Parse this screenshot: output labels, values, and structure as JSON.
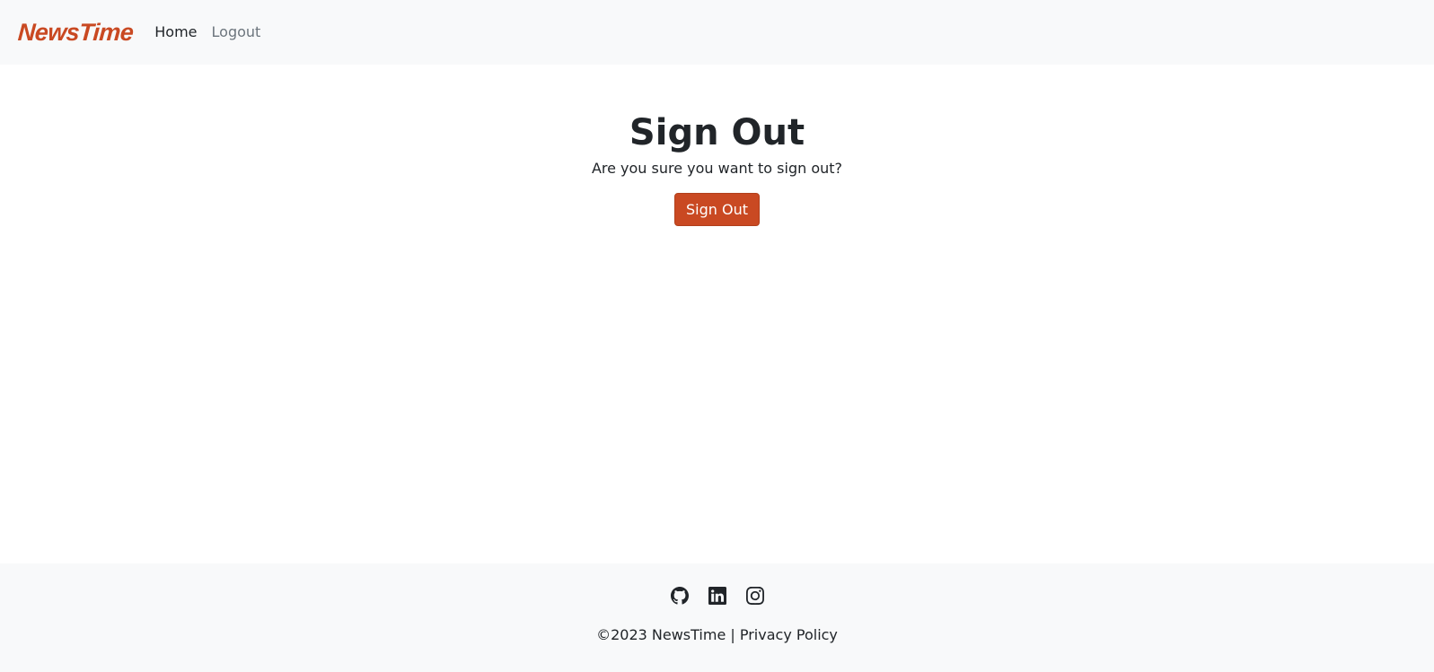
{
  "navbar": {
    "brand": "NewsTime",
    "links": [
      {
        "label": "Home"
      },
      {
        "label": "Logout"
      }
    ]
  },
  "main": {
    "title": "Sign Out",
    "subtitle": "Are you sure you want to sign out?",
    "button_label": "Sign Out"
  },
  "footer": {
    "social_icons": [
      "github-icon",
      "linkedin-icon",
      "instagram-icon"
    ],
    "copyright": "©2023 NewsTime |",
    "privacy_link": "Privacy Policy"
  },
  "colors": {
    "brand": "#c94922",
    "navbar_bg": "#f8f9fa",
    "footer_bg": "#f8f9fa",
    "text": "#212529",
    "muted": "#6c757d"
  }
}
